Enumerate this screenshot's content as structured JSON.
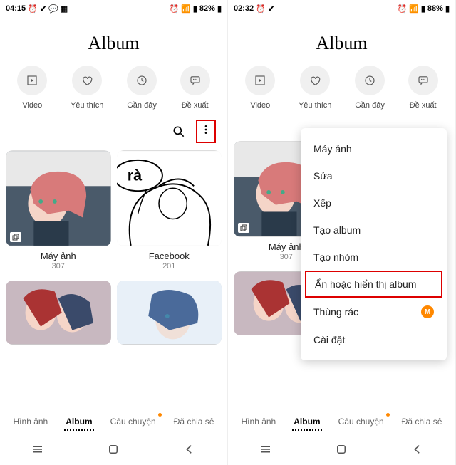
{
  "left": {
    "status": {
      "time": "04:15",
      "icons_left": [
        "alarm",
        "check",
        "msg",
        "photo"
      ],
      "icons_right": [
        "alarm",
        "wifi",
        "signal"
      ],
      "battery": "82%"
    },
    "title": "Album",
    "topbtns": [
      {
        "icon": "play",
        "label": "Video"
      },
      {
        "icon": "heart",
        "label": "Yêu thích"
      },
      {
        "icon": "clock",
        "label": "Gần đây"
      },
      {
        "icon": "bubble",
        "label": "Đề xuất"
      }
    ],
    "albums": [
      {
        "name": "Máy ảnh",
        "count": "307",
        "img": "girl-pink"
      },
      {
        "name": "Facebook",
        "count": "201",
        "img": "manga",
        "overlay": "rà"
      }
    ],
    "tabs": [
      {
        "label": "Hình ảnh"
      },
      {
        "label": "Album",
        "active": true
      },
      {
        "label": "Câu chuyện",
        "dot": true
      },
      {
        "label": "Đã chia sẻ"
      }
    ]
  },
  "right": {
    "status": {
      "time": "02:32",
      "icons_left": [
        "alarm",
        "check"
      ],
      "icons_right": [
        "alarm",
        "wifi",
        "signal"
      ],
      "battery": "88%"
    },
    "title": "Album",
    "topbtns": [
      {
        "icon": "play",
        "label": "Video"
      },
      {
        "icon": "heart",
        "label": "Yêu thích"
      },
      {
        "icon": "clock",
        "label": "Gần đây"
      },
      {
        "icon": "bubble",
        "label": "Đề xuất"
      }
    ],
    "albums": [
      {
        "name": "Máy ảnh",
        "count": "307",
        "img": "girl-pink"
      }
    ],
    "menu": [
      {
        "label": "Máy ảnh"
      },
      {
        "label": "Sửa"
      },
      {
        "label": "Xếp"
      },
      {
        "label": "Tạo album"
      },
      {
        "label": "Tạo nhóm"
      },
      {
        "label": "Ẩn hoặc hiển thị album",
        "boxed": true
      },
      {
        "label": "Thùng rác",
        "badge": "M"
      },
      {
        "label": "Cài đặt"
      }
    ],
    "tabs": [
      {
        "label": "Hình ảnh"
      },
      {
        "label": "Album",
        "active": true
      },
      {
        "label": "Câu chuyện",
        "dot": true
      },
      {
        "label": "Đã chia sẻ"
      }
    ]
  }
}
